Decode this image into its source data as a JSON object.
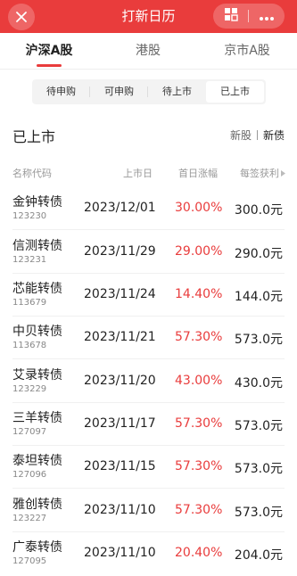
{
  "header": {
    "title": "打新日历",
    "close_icon": "close-icon",
    "grid_icon": "grid-icon",
    "more_icon": "more-icon"
  },
  "market_tabs": [
    {
      "label": "沪深A股",
      "active": true
    },
    {
      "label": "港股",
      "active": false
    },
    {
      "label": "京市A股",
      "active": false
    }
  ],
  "segments": [
    {
      "label": "待申购",
      "active": false
    },
    {
      "label": "可申购",
      "active": false
    },
    {
      "label": "待上市",
      "active": false
    },
    {
      "label": "已上市",
      "active": true
    }
  ],
  "section": {
    "title": "已上市",
    "filter_new_stock": "新股",
    "filter_new_bond": "新债"
  },
  "columns": {
    "name": "名称代码",
    "listing_date": "上市日",
    "first_day_gain": "首日涨幅",
    "profit_per_lot": "每签获利"
  },
  "rows": [
    {
      "name": "金钟转债",
      "code": "123230",
      "date": "2023/12/01",
      "gain": "30.00%",
      "profit": "300.0元"
    },
    {
      "name": "信测转债",
      "code": "123231",
      "date": "2023/11/29",
      "gain": "29.00%",
      "profit": "290.0元"
    },
    {
      "name": "芯能转债",
      "code": "113679",
      "date": "2023/11/24",
      "gain": "14.40%",
      "profit": "144.0元"
    },
    {
      "name": "中贝转债",
      "code": "113678",
      "date": "2023/11/21",
      "gain": "57.30%",
      "profit": "573.0元"
    },
    {
      "name": "艾录转债",
      "code": "123229",
      "date": "2023/11/20",
      "gain": "43.00%",
      "profit": "430.0元"
    },
    {
      "name": "三羊转债",
      "code": "127097",
      "date": "2023/11/17",
      "gain": "57.30%",
      "profit": "573.0元"
    },
    {
      "name": "泰坦转债",
      "code": "127096",
      "date": "2023/11/15",
      "gain": "57.30%",
      "profit": "573.0元"
    },
    {
      "name": "雅创转债",
      "code": "123227",
      "date": "2023/11/10",
      "gain": "57.30%",
      "profit": "573.0元"
    },
    {
      "name": "广泰转债",
      "code": "127095",
      "date": "2023/11/10",
      "gain": "20.40%",
      "profit": "204.0元"
    }
  ],
  "colors": {
    "brand": "#e93c3c",
    "gain": "#e93c3c",
    "text": "#222222",
    "muted": "#999999"
  }
}
